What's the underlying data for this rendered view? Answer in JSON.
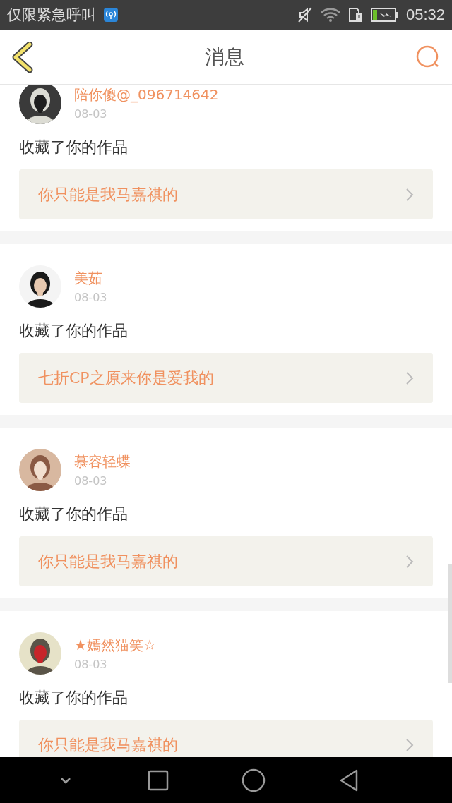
{
  "status_bar": {
    "carrier": "仅限紧急呼叫",
    "time": "05:32"
  },
  "header": {
    "title": "消息"
  },
  "messages": [
    {
      "user": "陪你傻@_096714642",
      "date": "08-03",
      "action": "收藏了你的作品",
      "work": "你只能是我马嘉祺的"
    },
    {
      "user": "美茹",
      "date": "08-03",
      "action": "收藏了你的作品",
      "work": "七折CP之原来你是爱我的"
    },
    {
      "user": "慕容轻蝶",
      "date": "08-03",
      "action": "收藏了你的作品",
      "work": "你只能是我马嘉祺的"
    },
    {
      "user": "★嫣然猫笑☆",
      "date": "08-03",
      "action": "收藏了你的作品",
      "work": "你只能是我马嘉祺的"
    }
  ]
}
